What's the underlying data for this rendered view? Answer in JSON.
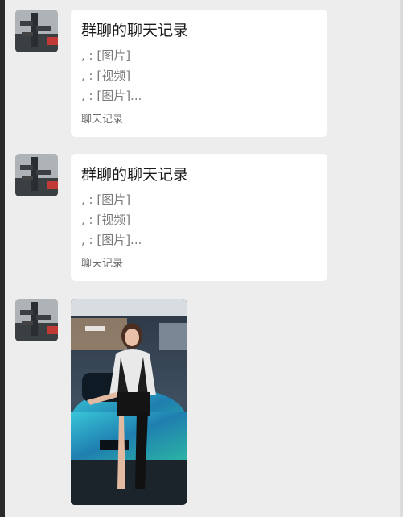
{
  "messages": [
    {
      "type": "chat_record",
      "title": "群聊的聊天记录",
      "lines": [
        ",  : [图片]",
        ",  : [视频]",
        ",  : [图片]..."
      ],
      "footer": "聊天记录"
    },
    {
      "type": "chat_record",
      "title": "群聊的聊天记录",
      "lines": [
        ",  : [图片]",
        ",  : [视频]",
        ",  : [图片]..."
      ],
      "footer": "聊天记录"
    },
    {
      "type": "image",
      "icon": "photo-car-show"
    }
  ],
  "colors": {
    "background": "#ededed",
    "card": "#ffffff",
    "title": "#1a1a1a",
    "line": "#7a7a7a"
  }
}
